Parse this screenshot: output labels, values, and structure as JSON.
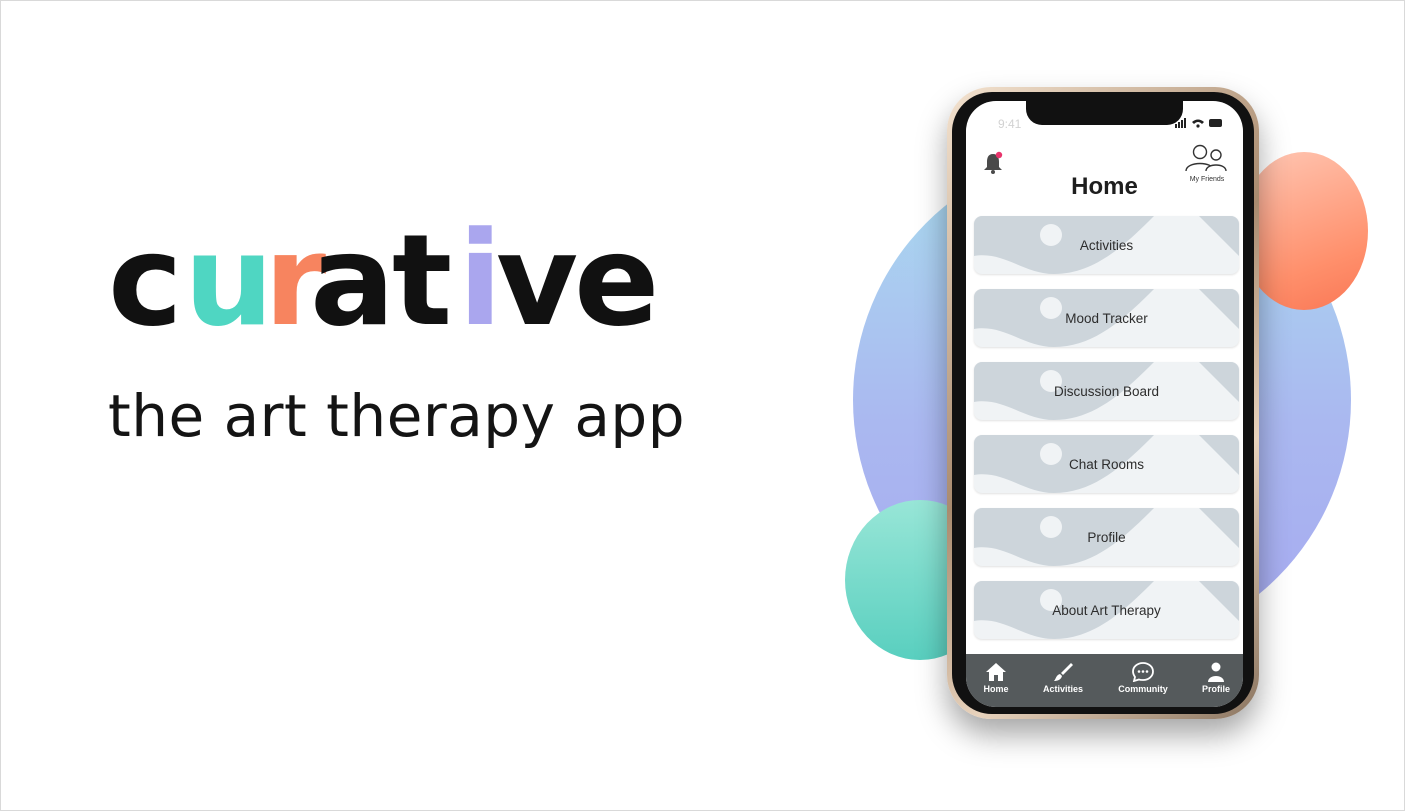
{
  "brand": {
    "logo_letters": [
      {
        "ch": "c",
        "color": "#111111"
      },
      {
        "ch": "u",
        "color": "#4fd6c2"
      },
      {
        "ch": "r",
        "color": "#f7845f"
      },
      {
        "ch": "a",
        "color": "#111111"
      },
      {
        "ch": "t",
        "color": "#111111"
      },
      {
        "ch": "i",
        "color": "#aaa6ee"
      },
      {
        "ch": "v",
        "color": "#111111"
      },
      {
        "ch": "e",
        "color": "#111111"
      }
    ],
    "tagline": "the art therapy app"
  },
  "phone": {
    "status_time": "9:41",
    "title": "Home",
    "notification_icon": "bell-icon",
    "friends_label": "My Friends",
    "menu": [
      {
        "label": "Activities"
      },
      {
        "label": "Mood Tracker"
      },
      {
        "label": "Discussion Board"
      },
      {
        "label": "Chat Rooms"
      },
      {
        "label": "Profile"
      },
      {
        "label": "About Art Therapy"
      }
    ],
    "tabs": [
      {
        "label": "Home",
        "icon": "house-icon"
      },
      {
        "label": "Activities",
        "icon": "brush-icon"
      },
      {
        "label": "Community",
        "icon": "chat-bubble-icon"
      },
      {
        "label": "Profile",
        "icon": "person-icon"
      }
    ]
  },
  "colors": {
    "accent_teal": "#4fd6c2",
    "accent_orange": "#f7845f",
    "accent_lavender": "#aaa6ee",
    "tabbar": "#555a5c"
  }
}
